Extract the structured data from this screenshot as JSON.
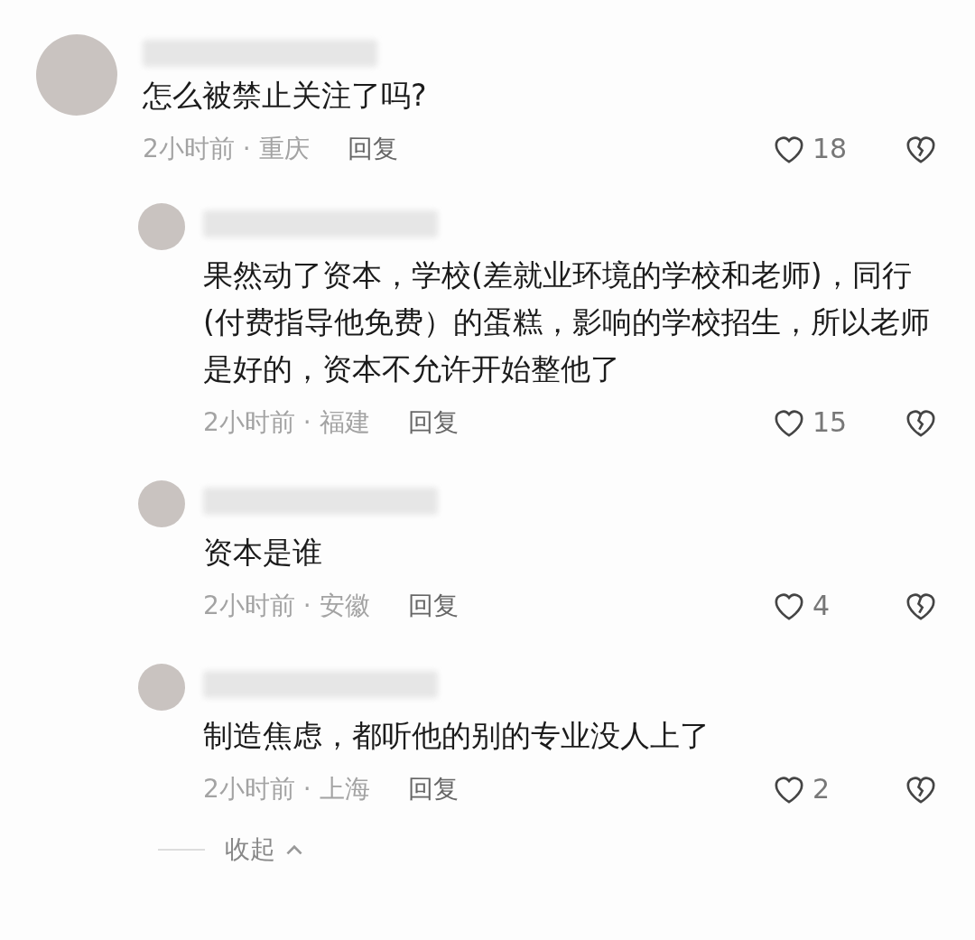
{
  "comments": [
    {
      "text": "怎么被禁止关注了吗?",
      "meta": "2小时前 · 重庆",
      "reply": "回复",
      "likes": "18",
      "replies": [
        {
          "text": "果然动了资本，学校(差就业环境的学校和老师)，同行(付费指导他免费）的蛋糕，影响的学校招生，所以老师是好的，资本不允许开始整他了",
          "meta": "2小时前 · 福建",
          "reply": "回复",
          "likes": "15"
        },
        {
          "text": "资本是谁",
          "meta": "2小时前 · 安徽",
          "reply": "回复",
          "likes": "4"
        },
        {
          "text": "制造焦虑，都听他的别的专业没人上了",
          "meta": "2小时前 · 上海",
          "reply": "回复",
          "likes": "2"
        }
      ]
    }
  ],
  "collapse": "收起"
}
